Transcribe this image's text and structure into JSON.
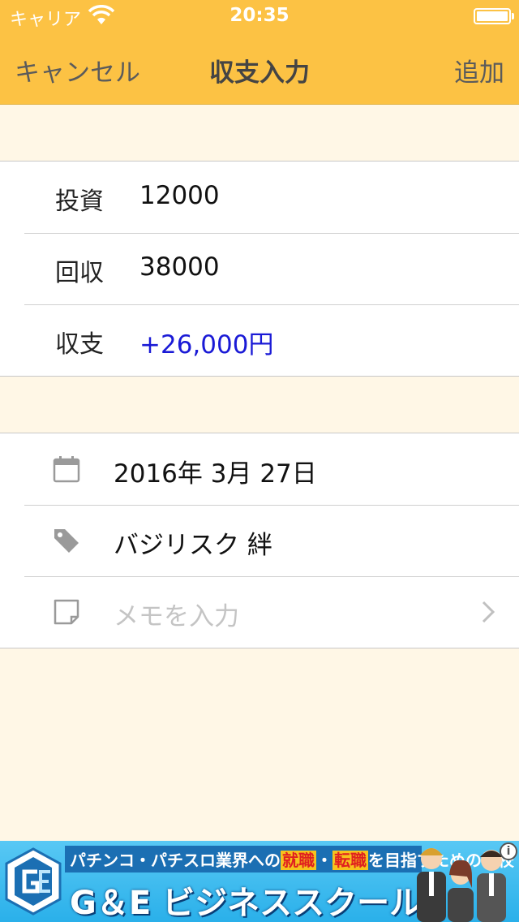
{
  "status_bar": {
    "carrier": "キャリア",
    "time": "20:35"
  },
  "navbar": {
    "cancel_label": "キャンセル",
    "title": "収支入力",
    "add_label": "追加"
  },
  "summary": {
    "rows": [
      {
        "label": "投資",
        "value": "12000"
      },
      {
        "label": "回収",
        "value": "38000"
      },
      {
        "label": "収支",
        "value": "+26,000円"
      }
    ]
  },
  "details": {
    "date": "2016年 3月 27日",
    "machine": "バジリスク 絆",
    "memo_placeholder": "メモを入力"
  },
  "ad": {
    "tagline_pre": "パチンコ・パチスロ業界への",
    "tagline_hl1": "就職",
    "tagline_sep": "・",
    "tagline_hl2": "転職",
    "tagline_post": "を目指すための学校",
    "title": "G＆E ビジネススクール",
    "info": "i"
  },
  "colors": {
    "navbar": "#fcc244",
    "background": "#fff7e6",
    "positive_value": "#1a1ad6"
  }
}
